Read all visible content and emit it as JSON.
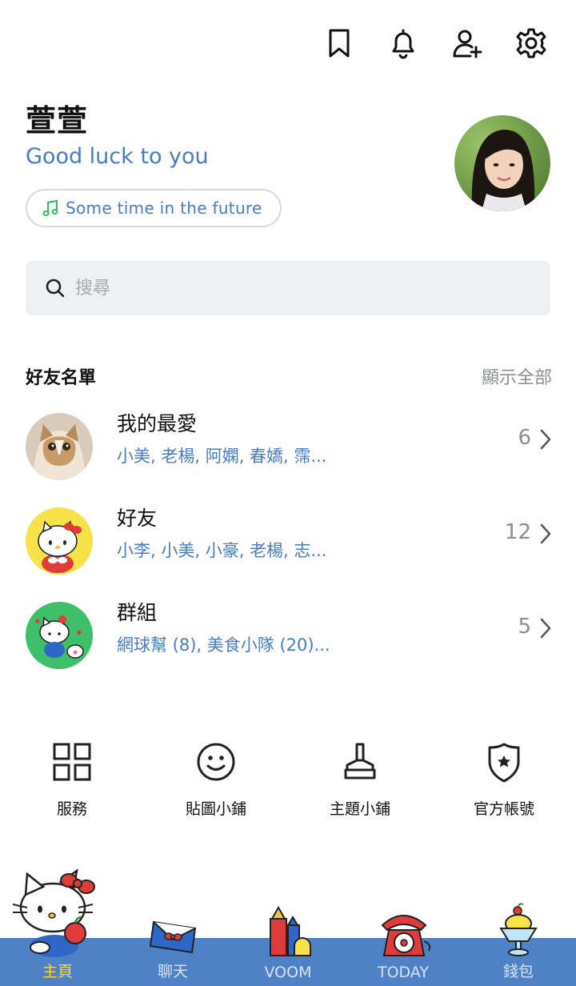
{
  "header": {
    "icons": [
      "bookmark-icon",
      "bell-icon",
      "add-friend-icon",
      "gear-icon"
    ]
  },
  "profile": {
    "name": "萱萱",
    "status": "Good luck to you",
    "music": "Some time in the future"
  },
  "search": {
    "placeholder": "搜尋"
  },
  "friends": {
    "title": "好友名單",
    "show_all": "顯示全部",
    "groups": [
      {
        "name": "我的最愛",
        "members": "小美, 老楊, 阿嫻, 春嬌, 霈...",
        "count": "6"
      },
      {
        "name": "好友",
        "members": "小李, 小美, 小豪, 老楊, 志...",
        "count": "12"
      },
      {
        "name": "群組",
        "members": "網球幫 (8), 美食小隊 (20)...",
        "count": "5"
      }
    ]
  },
  "services": [
    {
      "label": "服務",
      "icon": "grid-icon"
    },
    {
      "label": "貼圖小鋪",
      "icon": "smiley-icon"
    },
    {
      "label": "主題小鋪",
      "icon": "brush-icon"
    },
    {
      "label": "官方帳號",
      "icon": "shield-star-icon"
    }
  ],
  "tabs": [
    {
      "label": "主頁",
      "active": true
    },
    {
      "label": "聊天",
      "active": false
    },
    {
      "label": "VOOM",
      "active": false
    },
    {
      "label": "TODAY",
      "active": false
    },
    {
      "label": "錢包",
      "active": false
    }
  ],
  "colors": {
    "accent_blue": "#4a7cc2",
    "tabbar": "#4f81c7",
    "active_tab": "#ffd43b"
  }
}
